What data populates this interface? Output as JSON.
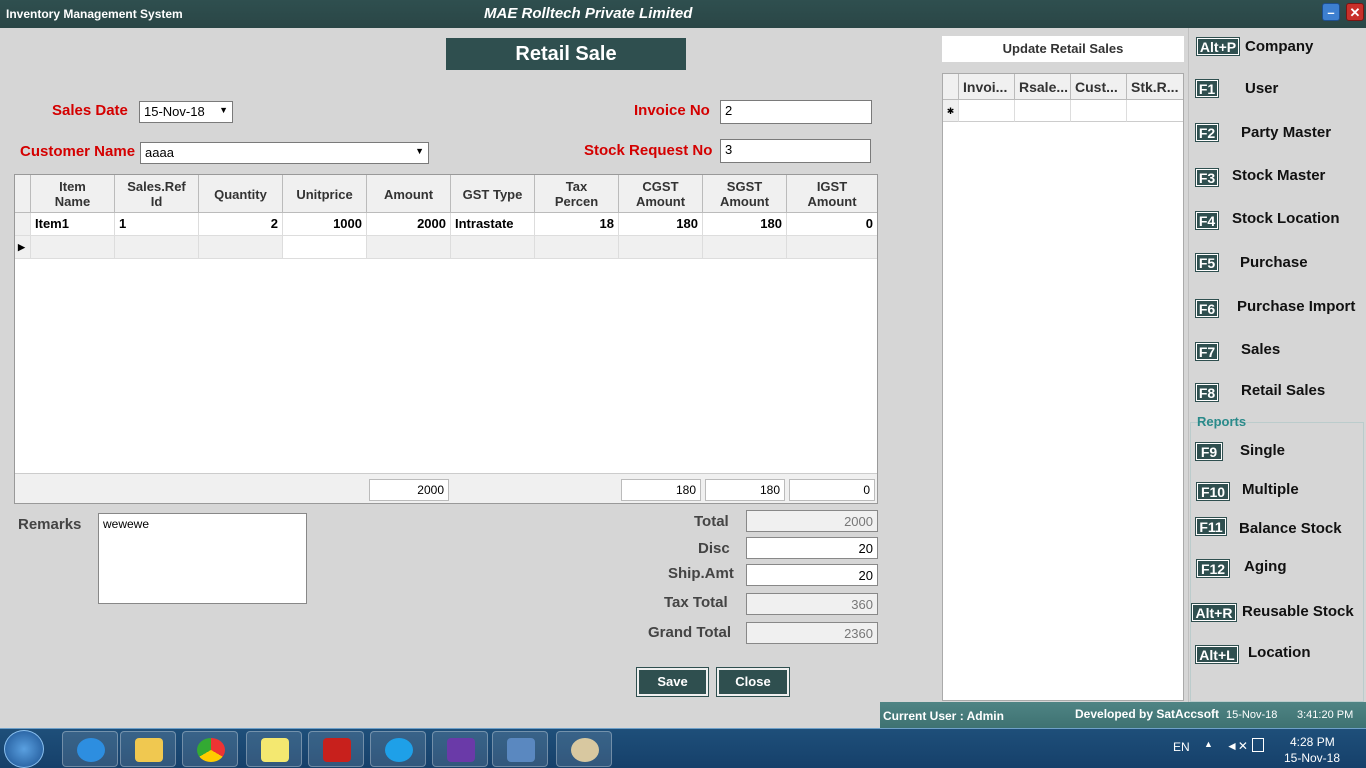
{
  "titlebar": {
    "app": "Inventory Management System",
    "company": "MAE Rolltech Private Limited",
    "minimize": "–",
    "close": "✕"
  },
  "form": {
    "title": "Retail Sale",
    "sales_date_label": "Sales Date",
    "sales_date": "15-Nov-18",
    "invoice_label": "Invoice No",
    "invoice_no": "2",
    "customer_label": "Customer Name",
    "customer": "aaaa",
    "stock_req_label": "Stock Request No",
    "stock_req_no": "3"
  },
  "grid": {
    "columns": [
      "Item\nName",
      "Sales.Ref\nId",
      "Quantity",
      "Unitprice",
      "Amount",
      "GST Type",
      "Tax\nPercen",
      "CGST\nAmount",
      "SGST\nAmount",
      "IGST\nAmount"
    ],
    "rows": [
      {
        "item": "Item1",
        "ref": "1",
        "qty": "2",
        "price": "1000",
        "amount": "2000",
        "gst": "Intrastate",
        "tax": "18",
        "cgst": "180",
        "sgst": "180",
        "igst": "0"
      }
    ],
    "footer": {
      "amount": "2000",
      "cgst": "180",
      "sgst": "180",
      "igst": "0"
    }
  },
  "remarks": {
    "label": "Remarks",
    "value": "wewewe"
  },
  "totals": {
    "total_label": "Total",
    "total": "2000",
    "disc_label": "Disc",
    "disc": "20",
    "ship_label": "Ship.Amt",
    "ship": "20",
    "tax_label": "Tax Total",
    "tax": "360",
    "grand_label": "Grand Total",
    "grand": "2360"
  },
  "buttons": {
    "save": "Save",
    "close": "Close"
  },
  "update_panel": {
    "title": "Update Retail Sales",
    "columns": [
      "Invoi...",
      "Rsale...",
      "Cust...",
      "Stk.R..."
    ],
    "new_row_marker": "✱"
  },
  "menu": {
    "items": [
      {
        "key": "Alt+P",
        "label": "Company"
      },
      {
        "key": "F1",
        "label": "User"
      },
      {
        "key": "F2",
        "label": "Party Master"
      },
      {
        "key": "F3",
        "label": "Stock Master"
      },
      {
        "key": "F4",
        "label": "Stock Location"
      },
      {
        "key": "F5",
        "label": "Purchase"
      },
      {
        "key": "F6",
        "label": "Purchase Import"
      },
      {
        "key": "F7",
        "label": "Sales"
      },
      {
        "key": "F8",
        "label": "Retail Sales"
      }
    ],
    "reports_label": "Reports",
    "reports": [
      {
        "key": "F9",
        "label": "Single"
      },
      {
        "key": "F10",
        "label": "Multiple"
      },
      {
        "key": "F11",
        "label": "Balance Stock"
      },
      {
        "key": "F12",
        "label": "Aging"
      },
      {
        "key": "Alt+R",
        "label": "Reusable Stock"
      },
      {
        "key": "Alt+L",
        "label": "Location"
      }
    ]
  },
  "status": {
    "user": "Current User : Admin",
    "dev": "Developed by SatAccsoft",
    "date": "15-Nov-18",
    "time": "3:41:20 PM"
  },
  "taskbar": {
    "lang": "EN",
    "time": "4:28 PM",
    "date": "15-Nov-18"
  },
  "colors": {
    "accent": "#2f4f4f",
    "label_red": "#d40000"
  }
}
